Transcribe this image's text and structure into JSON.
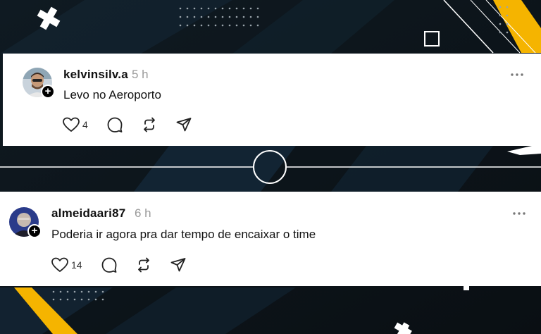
{
  "posts": [
    {
      "username": "kelvinsilv.a",
      "time": "5 h",
      "text": "Levo no Aeroporto",
      "likes": "4",
      "follow_icon": "plus-icon"
    },
    {
      "username": "almeidaari87",
      "time": "6 h",
      "text": "Poderia ir agora pra dar tempo de encaixar o time",
      "likes": "14",
      "follow_icon": "plus-icon"
    }
  ],
  "colors": {
    "background": "#0b1116",
    "accent_yellow": "#f5b400",
    "card": "#ffffff"
  }
}
